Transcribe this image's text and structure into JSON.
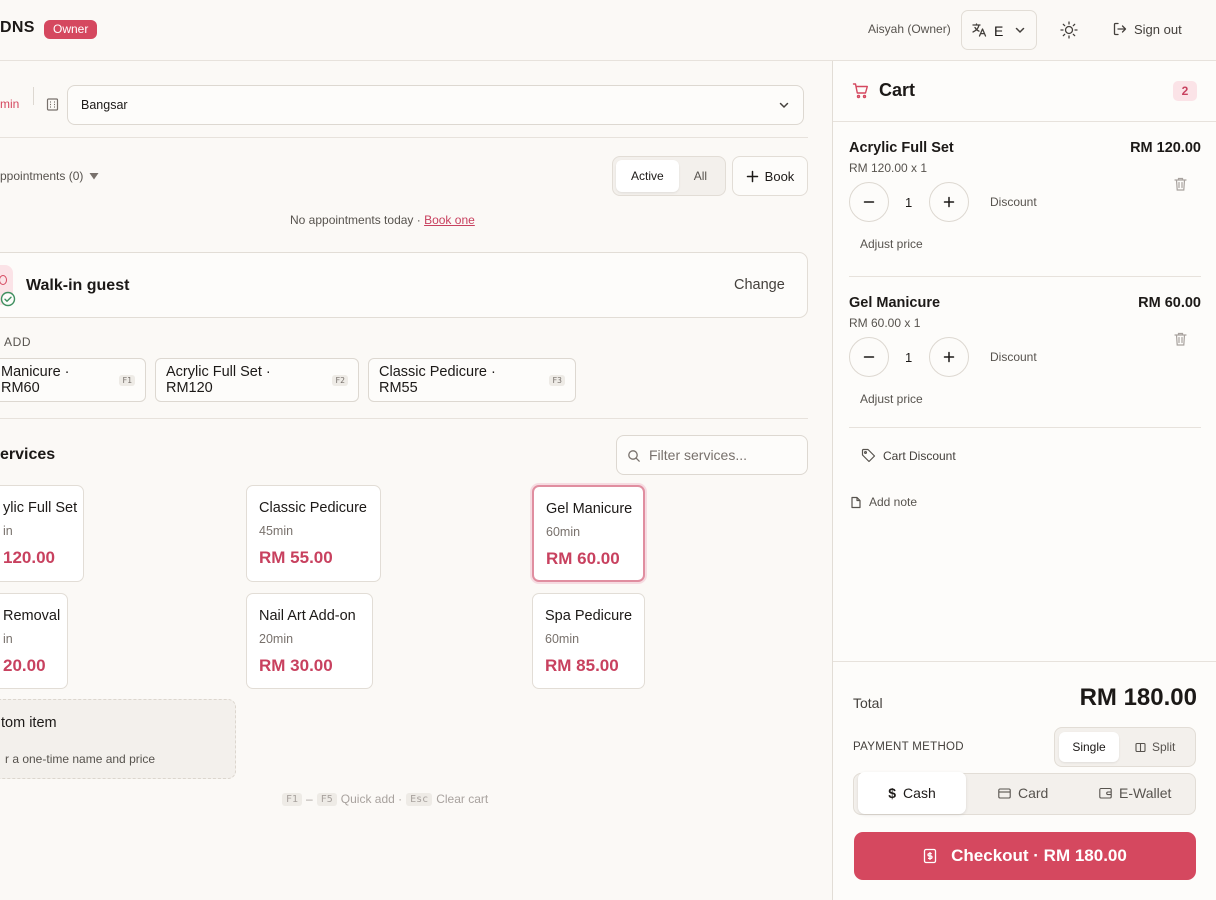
{
  "header": {
    "brand": "DNS",
    "role_badge": "Owner",
    "user_name": "Aisyah (Owner)",
    "language": "E",
    "sign_out": "Sign out"
  },
  "toolbar": {
    "duration": "min",
    "branch": "Bangsar"
  },
  "appointments": {
    "title": "ppointments (0)",
    "filters": [
      "Active",
      "All"
    ],
    "active_filter": "Active",
    "book_label": "Book",
    "empty_text": "No appointments today · ",
    "empty_link": "Book one"
  },
  "guest": {
    "name": "Walk-in guest",
    "change_label": "Change"
  },
  "quick_add": {
    "label": "ADD",
    "items": [
      {
        "label": "Manicure · RM60",
        "key": "F1"
      },
      {
        "label": "Acrylic Full Set · RM120",
        "key": "F2"
      },
      {
        "label": "Classic Pedicure · RM55",
        "key": "F3"
      }
    ]
  },
  "services": {
    "title": "ervices",
    "filter_placeholder": "Filter services...",
    "items": [
      {
        "name": "ylic Full Set",
        "duration": "in",
        "price": "120.00"
      },
      {
        "name": "Classic Pedicure",
        "duration": "45min",
        "price": "RM 55.00"
      },
      {
        "name": "Gel Manicure",
        "duration": "60min",
        "price": "RM 60.00",
        "selected": true
      },
      {
        "name": "Removal",
        "duration": "in",
        "price": "20.00"
      },
      {
        "name": "Nail Art Add-on",
        "duration": "20min",
        "price": "RM 30.00"
      },
      {
        "name": "Spa Pedicure",
        "duration": "60min",
        "price": "RM 85.00"
      }
    ],
    "custom_title": "tom item",
    "custom_desc": "r a one-time name and price"
  },
  "shortcuts": {
    "key1": "F1",
    "dash": "–",
    "key2": "F5",
    "quick_add": "Quick add ·",
    "key3": "Esc",
    "clear": "Clear cart"
  },
  "cart": {
    "title": "Cart",
    "count": "2",
    "items": [
      {
        "name": "Acrylic Full Set",
        "unit": "RM 120.00 x 1",
        "total": "RM 120.00",
        "qty": "1",
        "discount": "Discount",
        "adjust": "Adjust price"
      },
      {
        "name": "Gel Manicure",
        "unit": "RM 60.00 x 1",
        "total": "RM 60.00",
        "qty": "1",
        "discount": "Discount",
        "adjust": "Adjust price"
      }
    ],
    "cart_discount": "Cart Discount",
    "add_note": "Add note",
    "total_label": "Total",
    "total_value": "RM 180.00",
    "payment_label": "PAYMENT METHOD",
    "payment_modes": [
      "Single",
      "Split"
    ],
    "payment_methods": [
      "Cash",
      "Card",
      "E-Wallet"
    ],
    "selected_method": "Cash",
    "checkout": "Checkout · RM 180.00"
  },
  "colors": {
    "accent": "#d5485f",
    "price": "#c8415f",
    "background": "#fbf9f6"
  }
}
